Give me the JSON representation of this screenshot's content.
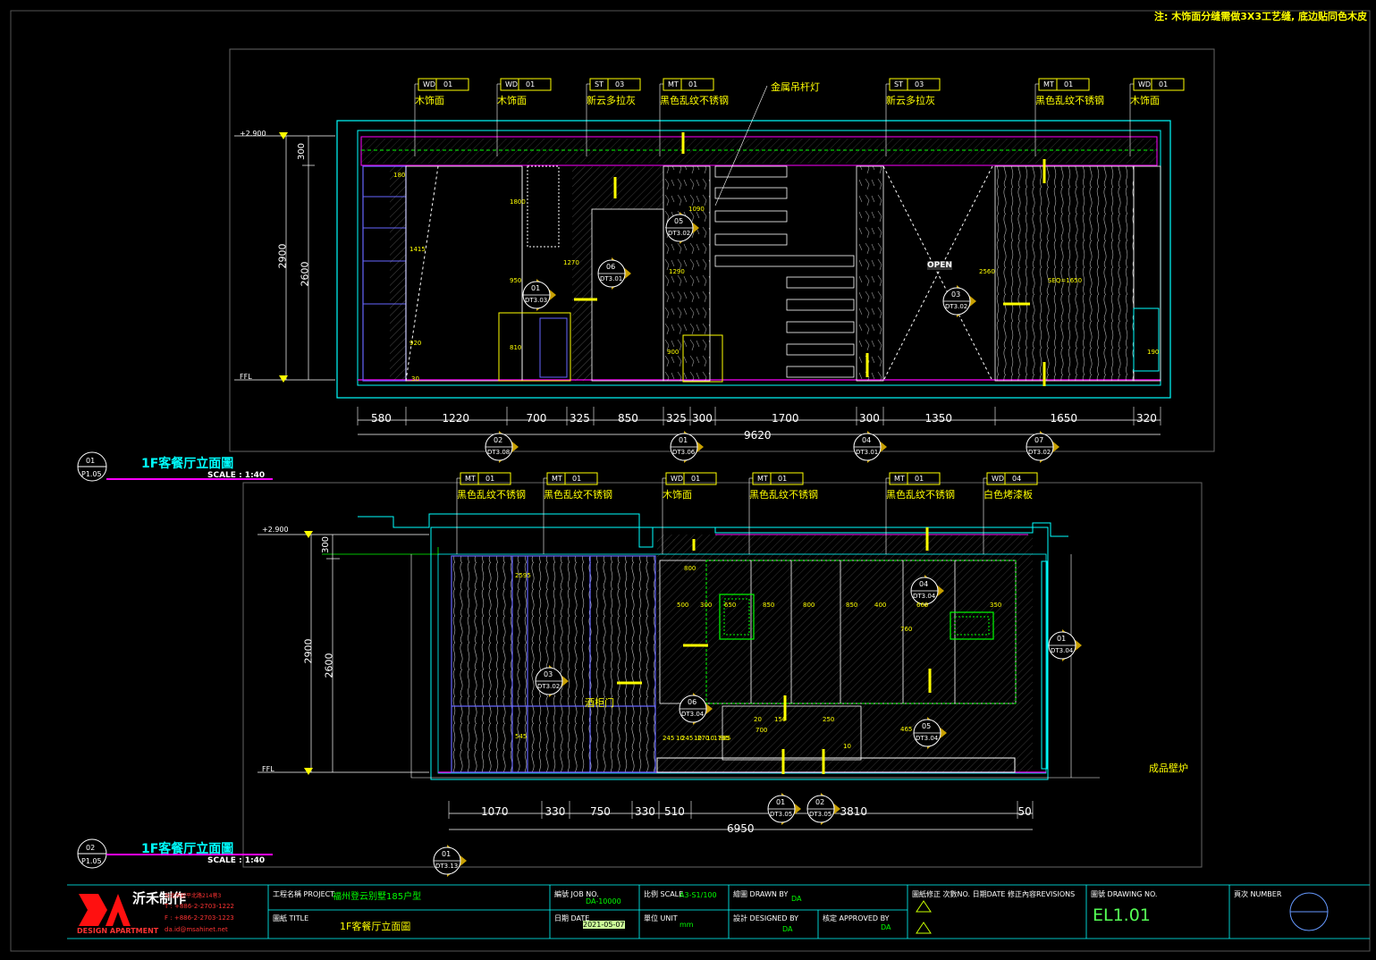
{
  "note": "注: 木饰面分缝需做3X3工艺缝, 底边贴同色木皮",
  "elevation1": {
    "title": "1F客餐厅立面圖",
    "scale": "SCALE :   1:40",
    "tag_num": "01",
    "tag_sheet": "P1.05",
    "levels": [
      "+2.900",
      "FFL"
    ],
    "vertical_dims": [
      "300",
      "2900",
      "2600"
    ],
    "material_tags": [
      {
        "code": "WD",
        "num": "01",
        "label": "木饰面"
      },
      {
        "code": "WD",
        "num": "01",
        "label": "木饰面"
      },
      {
        "code": "ST",
        "num": "03",
        "label": "新云多拉灰"
      },
      {
        "code": "MT",
        "num": "01",
        "label": "黑色乱纹不锈钢"
      },
      {
        "code": "",
        "num": "",
        "label": "金属吊杆灯"
      },
      {
        "code": "ST",
        "num": "03",
        "label": "新云多拉灰"
      },
      {
        "code": "MT",
        "num": "01",
        "label": "黑色乱纹不锈钢"
      },
      {
        "code": "WD",
        "num": "01",
        "label": "木饰面"
      }
    ],
    "bottom_dims": [
      "580",
      "1220",
      "700",
      "325",
      "850",
      "325",
      "300",
      "1700",
      "300",
      "1350",
      "1650",
      "320"
    ],
    "total_dim": "9620",
    "callouts_bottom": [
      {
        "num": "02",
        "sheet": "DT3.08"
      },
      {
        "num": "01",
        "sheet": "DT3.06"
      },
      {
        "num": "04",
        "sheet": "DT3.01"
      },
      {
        "num": "07",
        "sheet": "DT3.02"
      }
    ],
    "callouts_inner": [
      {
        "num": "01",
        "sheet": "DT3.03"
      },
      {
        "num": "06",
        "sheet": "DT3.01"
      },
      {
        "num": "05",
        "sheet": "DT3.02"
      },
      {
        "num": "03",
        "sheet": "DT3.02"
      }
    ],
    "open_label": "OPEN",
    "inner_dims": [
      "180",
      "1800",
      "1270",
      "1290",
      "1090",
      "1415",
      "950",
      "810",
      "920",
      "900",
      "2560",
      "SEQ=1650",
      "190",
      "30"
    ]
  },
  "elevation2": {
    "title": "1F客餐厅立面圖",
    "scale": "SCALE :   1:40",
    "tag_num": "02",
    "tag_sheet": "P1.05",
    "levels": [
      "+2.900",
      "FFL"
    ],
    "vertical_dims": [
      "300",
      "2900",
      "2600"
    ],
    "material_tags": [
      {
        "code": "MT",
        "num": "01",
        "label": "黑色乱纹不锈钢"
      },
      {
        "code": "MT",
        "num": "01",
        "label": "黑色乱纹不锈钢"
      },
      {
        "code": "WD",
        "num": "01",
        "label": "木饰面"
      },
      {
        "code": "MT",
        "num": "01",
        "label": "黑色乱纹不锈钢"
      },
      {
        "code": "MT",
        "num": "01",
        "label": "黑色乱纹不锈钢"
      },
      {
        "code": "WD",
        "num": "04",
        "label": "白色烤漆板"
      }
    ],
    "bottom_dims": [
      "1070",
      "330",
      "750",
      "330",
      "510",
      "3810",
      "50"
    ],
    "total_dim": "6950",
    "callouts_bottom": [
      {
        "num": "01",
        "sheet": "DT3.05"
      },
      {
        "num": "02",
        "sheet": "DT3.05"
      },
      {
        "num": "01",
        "sheet": "DT3.13"
      }
    ],
    "callouts_inner": [
      {
        "num": "04",
        "sheet": "DT3.04"
      },
      {
        "num": "01",
        "sheet": "DT3.04"
      },
      {
        "num": "03",
        "sheet": "DT3.02"
      },
      {
        "num": "06",
        "sheet": "DT3.04"
      },
      {
        "num": "05",
        "sheet": "DT3.04"
      }
    ],
    "fireplace_label": "成品壁炉",
    "lamp_label": "酒柜门",
    "inner_dims": [
      "800",
      "500",
      "300",
      "650",
      "850",
      "800",
      "850",
      "400",
      "660",
      "350",
      "20",
      "150",
      "700",
      "250",
      "10",
      "245",
      "10",
      "245",
      "10",
      "270",
      "10",
      "1735",
      "885",
      "760",
      "465",
      "545",
      "2595"
    ]
  },
  "titleblock": {
    "company_cn": "沂禾制作",
    "company_en": "DESIGN APARTMENT",
    "address": "台北市延平北路214巷3",
    "tel": "T : +886-2-2703-1222",
    "fax": "F : +886-2-2703-1223",
    "email": "da.id@msahinet.net",
    "project_label": "工程名稱 PROJECT",
    "project_value": "福州登云别墅185户型",
    "title_label": "圖紙 TITLE",
    "title_value": "1F客餐厅立面圖",
    "job_label": "編號 JOB NO.",
    "job_value": "DA-10000",
    "date_label": "日期 DATE",
    "date_value": "2021-05-07",
    "scale_label": "比例 SCALE",
    "scale_value": "A3-S1/100",
    "unit_label": "單位 UNIT",
    "unit_value": "mm",
    "drawn_label": "繪圖 DRAWN BY",
    "drawn_value": "DA",
    "designed_label": "設計 DESIGNED BY",
    "designed_value": "DA",
    "approved_label": "核定 APPROVED BY",
    "approved_value": "DA",
    "revisions_label": "圖紙修正 次數NO.  日期DATE  修正內容REVISIONS",
    "drawing_no_label": "圖號 DRAWING NO.",
    "drawing_no_value": "EL1.01",
    "number_label": "頁次 NUMBER"
  },
  "colors": {
    "background": "#000000",
    "cyan": "#00ffff",
    "yellow": "#ffff00",
    "magenta": "#ff00ff",
    "white": "#ffffff",
    "green": "#00ff00",
    "blue": "#6666ff",
    "red": "#ff0000",
    "gold": "#c8a000"
  }
}
